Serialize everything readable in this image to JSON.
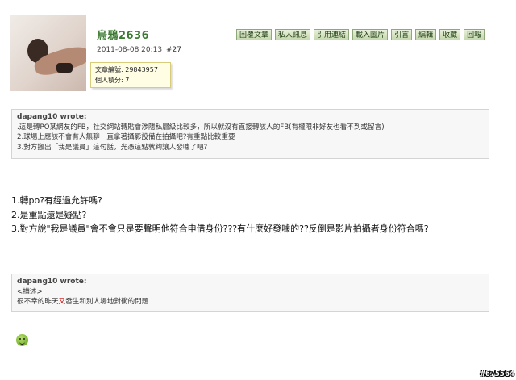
{
  "author": {
    "name": "烏鴉2636",
    "timestamp": "2011-08-08 20:13",
    "post_number": "#27",
    "tooltip_line1": "文章編號: 29843957",
    "tooltip_line2": "個人積分: 7"
  },
  "toolbar": {
    "buttons": [
      "回覆文章",
      "私人訊息",
      "引用連結",
      "載入圖片",
      "引言",
      "編輯",
      "收藏",
      "回報"
    ]
  },
  "quote1": {
    "author_line": "dapang10 wrote:",
    "lines": [
      ".這是轉PO某網友的FB，社交網站轉貼會涉隱私層級比較多，所以就沒有直接轉該人的FB(有權限非好友也看不到或留言)",
      "2.球場上應該不會有人無聊一直拿著攝影設備在拍攝吧?有重點比較重要",
      "3.對方搬出「我是議員」這句話，光憑這點就夠讓人發噱了吧?"
    ]
  },
  "reply": {
    "line1": "1.轉po?有經過允許嗎?",
    "line2": "2.是重點還是疑點?",
    "line3": "3.對方說\"我是議員\"會不會只是要聲明他符合申借身份???有什麼好發噱的??反倒是影片拍攝者身份符合嗎?"
  },
  "quote2": {
    "author_line": "dapang10 wrote:",
    "placeholder": "<描述>",
    "text_before": "很不幸的昨天",
    "text_highlight": "又",
    "text_after": "發生和別人場地對衝的問題"
  },
  "smiley_icon": "smiley-icon",
  "watermark": "#675564"
}
